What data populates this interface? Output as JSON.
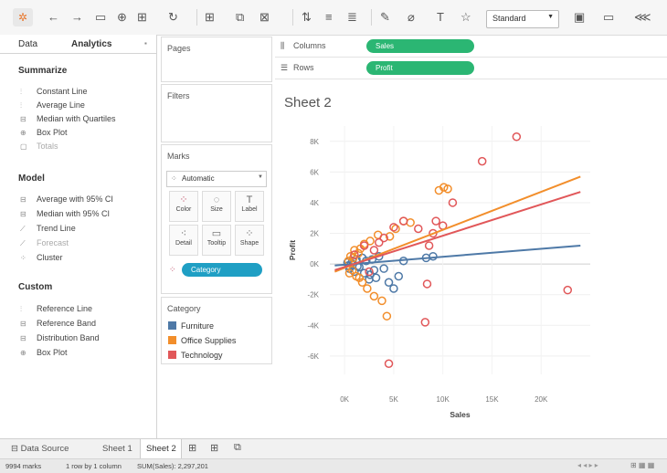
{
  "toolbar": {
    "view_dropdown": "Standard"
  },
  "left_pane": {
    "tabs": [
      "Data",
      "Analytics"
    ],
    "summarize": {
      "title": "Summarize",
      "items": [
        "Constant Line",
        "Average Line",
        "Median with Quartiles",
        "Box Plot",
        "Totals"
      ]
    },
    "model": {
      "title": "Model",
      "items": [
        "Average with 95% CI",
        "Median with 95% CI",
        "Trend Line",
        "Forecast",
        "Cluster"
      ]
    },
    "custom": {
      "title": "Custom",
      "items": [
        "Reference Line",
        "Reference Band",
        "Distribution Band",
        "Box Plot"
      ]
    }
  },
  "cards": {
    "pages": "Pages",
    "filters": "Filters",
    "marks": {
      "title": "Marks",
      "mark_type": "Automatic",
      "buttons": [
        "Color",
        "Size",
        "Label",
        "Detail",
        "Tooltip",
        "Shape"
      ],
      "color_pill": "Category"
    },
    "legend": {
      "title": "Category",
      "items": [
        {
          "label": "Furniture",
          "color": "#4e79a7"
        },
        {
          "label": "Office Supplies",
          "color": "#f28e2b"
        },
        {
          "label": "Technology",
          "color": "#e15759"
        }
      ]
    }
  },
  "shelves": {
    "columns_label": "Columns",
    "columns_pill": "Sales",
    "rows_label": "Rows",
    "rows_pill": "Profit"
  },
  "sheet": {
    "title": "Sheet 2"
  },
  "bottom": {
    "data_source": "Data Source",
    "sheets": [
      "Sheet 1",
      "Sheet 2"
    ],
    "active_sheet": "Sheet 2"
  },
  "status": {
    "marks": "9994 marks",
    "dims": "1 row by 1 column",
    "sum": "SUM(Sales): 2,297,201"
  },
  "chart_data": {
    "type": "scatter",
    "title": "",
    "xlabel": "Sales",
    "ylabel": "Profit",
    "xlim": [
      -1500,
      25000
    ],
    "ylim": [
      -7200,
      9000
    ],
    "x_ticks": [
      0,
      5000,
      10000,
      15000,
      20000
    ],
    "x_tick_labels": [
      "0K",
      "5K",
      "10K",
      "15K",
      "20K"
    ],
    "y_ticks": [
      -6000,
      -4000,
      -2000,
      0,
      2000,
      4000,
      6000,
      8000
    ],
    "y_tick_labels": [
      "-6K",
      "-4K",
      "-2K",
      "0K",
      "2K",
      "4K",
      "6K",
      "8K"
    ],
    "grid": true,
    "legend": "Category",
    "series": [
      {
        "name": "Furniture",
        "color": "#4e79a7",
        "points": [
          [
            300,
            100
          ],
          [
            500,
            -300
          ],
          [
            800,
            200
          ],
          [
            1000,
            -500
          ],
          [
            1200,
            300
          ],
          [
            1500,
            -200
          ],
          [
            1800,
            400
          ],
          [
            2000,
            -600
          ],
          [
            2200,
            200
          ],
          [
            2500,
            -1000
          ],
          [
            2800,
            300
          ],
          [
            3000,
            -400
          ],
          [
            3500,
            500
          ],
          [
            4000,
            -300
          ],
          [
            4500,
            -1200
          ],
          [
            5000,
            -1600
          ],
          [
            5500,
            -800
          ],
          [
            6000,
            200
          ],
          [
            8300,
            400
          ],
          [
            9000,
            500
          ],
          [
            400,
            -100
          ],
          [
            700,
            50
          ],
          [
            1300,
            -150
          ],
          [
            2600,
            -700
          ],
          [
            3200,
            -900
          ]
        ],
        "trend": [
          [
            -1000,
            -100
          ],
          [
            24000,
            1200
          ]
        ]
      },
      {
        "name": "Office Supplies",
        "color": "#f28e2b",
        "points": [
          [
            400,
            200
          ],
          [
            600,
            500
          ],
          [
            800,
            -400
          ],
          [
            1000,
            900
          ],
          [
            1200,
            -800
          ],
          [
            1400,
            700
          ],
          [
            1600,
            1000
          ],
          [
            1800,
            -1200
          ],
          [
            2000,
            1300
          ],
          [
            2300,
            -1600
          ],
          [
            2600,
            1500
          ],
          [
            3000,
            -2100
          ],
          [
            3400,
            1900
          ],
          [
            3800,
            -2400
          ],
          [
            4300,
            -3400
          ],
          [
            4600,
            1800
          ],
          [
            5200,
            2300
          ],
          [
            6000,
            2800
          ],
          [
            6700,
            2700
          ],
          [
            9600,
            4800
          ],
          [
            10100,
            5000
          ],
          [
            10500,
            4900
          ],
          [
            500,
            -600
          ],
          [
            900,
            400
          ],
          [
            1500,
            -900
          ]
        ],
        "trend": [
          [
            -1000,
            -500
          ],
          [
            24000,
            5700
          ]
        ]
      },
      {
        "name": "Technology",
        "color": "#e15759",
        "points": [
          [
            1000,
            600
          ],
          [
            2000,
            1200
          ],
          [
            3000,
            900
          ],
          [
            4000,
            1700
          ],
          [
            4500,
            -6500
          ],
          [
            5000,
            2400
          ],
          [
            6000,
            2800
          ],
          [
            7500,
            2300
          ],
          [
            8200,
            -3800
          ],
          [
            8400,
            -1300
          ],
          [
            8600,
            1200
          ],
          [
            9000,
            2000
          ],
          [
            9300,
            2800
          ],
          [
            10000,
            2500
          ],
          [
            11000,
            4000
          ],
          [
            14000,
            6700
          ],
          [
            17500,
            8300
          ],
          [
            22700,
            -1700
          ],
          [
            2500,
            -500
          ],
          [
            3500,
            1400
          ]
        ],
        "trend": [
          [
            -1000,
            -400
          ],
          [
            24000,
            4700
          ]
        ]
      }
    ]
  }
}
